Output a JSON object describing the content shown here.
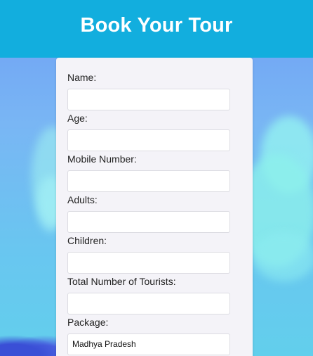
{
  "header": {
    "title": "Book Your Tour"
  },
  "form": {
    "fields": [
      {
        "label": "Name:",
        "value": ""
      },
      {
        "label": "Age:",
        "value": ""
      },
      {
        "label": "Mobile Number:",
        "value": ""
      },
      {
        "label": "Adults:",
        "value": ""
      },
      {
        "label": "Children:",
        "value": ""
      },
      {
        "label": "Total Number of Tourists:",
        "value": ""
      },
      {
        "label": "Package:",
        "value": "Madhya Pradesh"
      }
    ]
  },
  "colors": {
    "header_bg": "#12aede",
    "card_bg": "#f4f3f8",
    "sky": "#79b6f4"
  }
}
